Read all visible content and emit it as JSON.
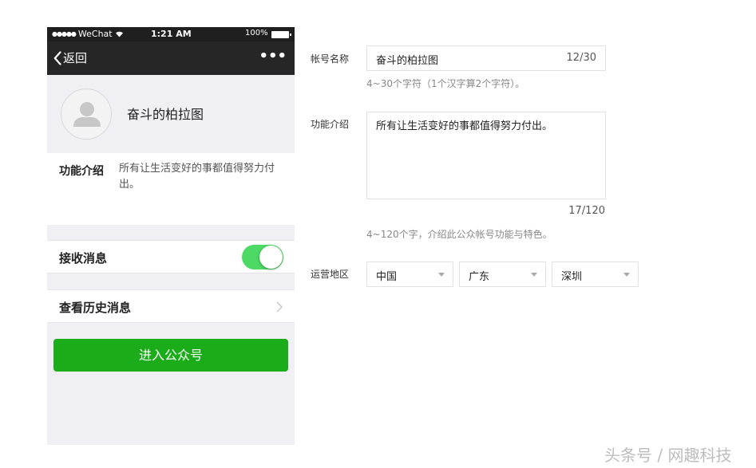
{
  "status_bar": {
    "signal_dots": "●●●●●",
    "carrier": "WeChat",
    "time": "1:21 AM",
    "battery": "100%"
  },
  "nav": {
    "back_label": "返回",
    "more_label": "•••"
  },
  "profile": {
    "name": "奋斗的柏拉图"
  },
  "intro": {
    "label": "功能介绍",
    "text": "所有让生活变好的事都值得努力付出。"
  },
  "rows": {
    "receive_label": "接收消息",
    "receive_enabled": true,
    "history_label": "查看历史消息"
  },
  "enter_button": "进入公众号",
  "form": {
    "name_label": "帐号名称",
    "name_value": "奋斗的柏拉图",
    "name_count": "12/30",
    "name_hint": "4~30个字符（1个汉字算2个字符）。",
    "intro_label": "功能介绍",
    "intro_value": "所有让生活变好的事都值得努力付出。",
    "intro_count": "17/120",
    "intro_hint": "4~120个字，介绍此公众帐号功能与特色。",
    "region_label": "运营地区",
    "country": "中国",
    "province": "广东",
    "city": "深圳"
  },
  "watermark": "头条号 / 网趣科技",
  "colors": {
    "toggle_on": "#4cd964",
    "primary_button": "#1aad19",
    "nav_bar": "#262626"
  },
  "icons": {
    "wifi": "wifi-icon",
    "battery": "battery-icon",
    "back": "chevron-left-icon",
    "more": "more-icon",
    "avatar": "avatar-placeholder-icon",
    "history": "chevron-right-icon",
    "dropdown": "caret-down-icon"
  }
}
